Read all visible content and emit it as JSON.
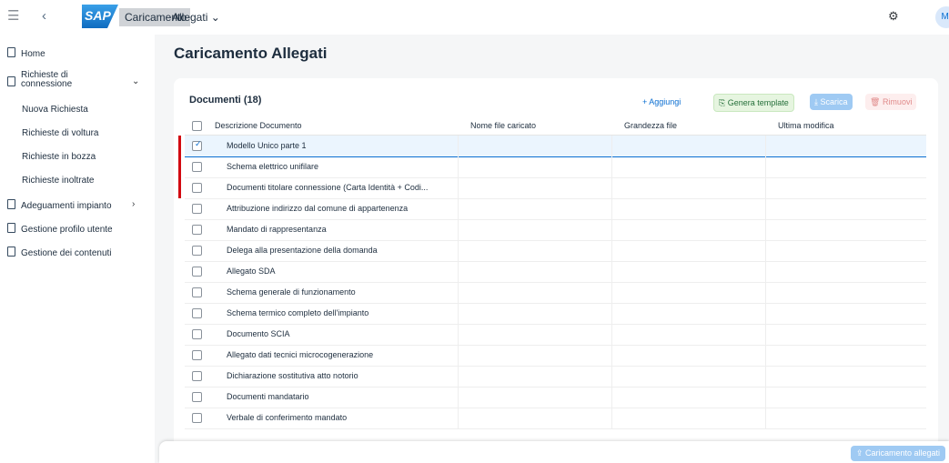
{
  "shell": {
    "title_highlight": "Caricamento",
    "title_rest": "Allegati ⌄",
    "logo_text": "SAP",
    "avatar_initials": "MI"
  },
  "sidebar": {
    "items": [
      {
        "label": "Home"
      },
      {
        "label": "Richieste di\nconnessione"
      },
      {
        "label": "Nuova Richiesta"
      },
      {
        "label": "Richieste di voltura"
      },
      {
        "label": "Richieste in bozza"
      },
      {
        "label": "Richieste inoltrate"
      },
      {
        "label": "Adeguamenti impianto"
      },
      {
        "label": "Gestione profilo utente"
      },
      {
        "label": "Gestione dei contenuti"
      }
    ]
  },
  "page": {
    "title": "Caricamento Allegati"
  },
  "table": {
    "title": "Documenti (18)",
    "toolbar": {
      "add": "+ Aggiungi",
      "template": "Genera template",
      "download": "Scarica",
      "remove": "Rimuovi"
    },
    "columns": [
      "Descrizione Documento",
      "Nome file caricato",
      "Grandezza file",
      "Ultima modifica"
    ],
    "rows": [
      {
        "desc": "Modello Unico parte 1",
        "selected": true,
        "marked": true
      },
      {
        "desc": "Schema elettrico unifilare",
        "selected": false,
        "marked": true
      },
      {
        "desc": "Documenti titolare connessione (Carta Identità + Codi...",
        "selected": false,
        "marked": true
      },
      {
        "desc": "Attribuzione indirizzo dal comune di appartenenza",
        "selected": false,
        "marked": false
      },
      {
        "desc": "Mandato di rappresentanza",
        "selected": false,
        "marked": false
      },
      {
        "desc": "Delega alla presentazione della domanda",
        "selected": false,
        "marked": false
      },
      {
        "desc": "Allegato SDA",
        "selected": false,
        "marked": false
      },
      {
        "desc": "Schema generale di funzionamento",
        "selected": false,
        "marked": false
      },
      {
        "desc": "Schema termico completo dell'impianto",
        "selected": false,
        "marked": false
      },
      {
        "desc": "Documento SCIA",
        "selected": false,
        "marked": false
      },
      {
        "desc": "Allegato dati tecnici microcogenerazione",
        "selected": false,
        "marked": false
      },
      {
        "desc": "Dichiarazione sostitutiva atto notorio",
        "selected": false,
        "marked": false
      },
      {
        "desc": "Documenti mandatario",
        "selected": false,
        "marked": false
      },
      {
        "desc": "Verbale di conferimento mandato",
        "selected": false,
        "marked": false
      }
    ]
  },
  "footer": {
    "upload_button": "Caricamento allegati"
  },
  "colors": {
    "accent": "#0a6ed1",
    "marker_red": "#d20a11",
    "selected_row": "#ebf5fe"
  }
}
